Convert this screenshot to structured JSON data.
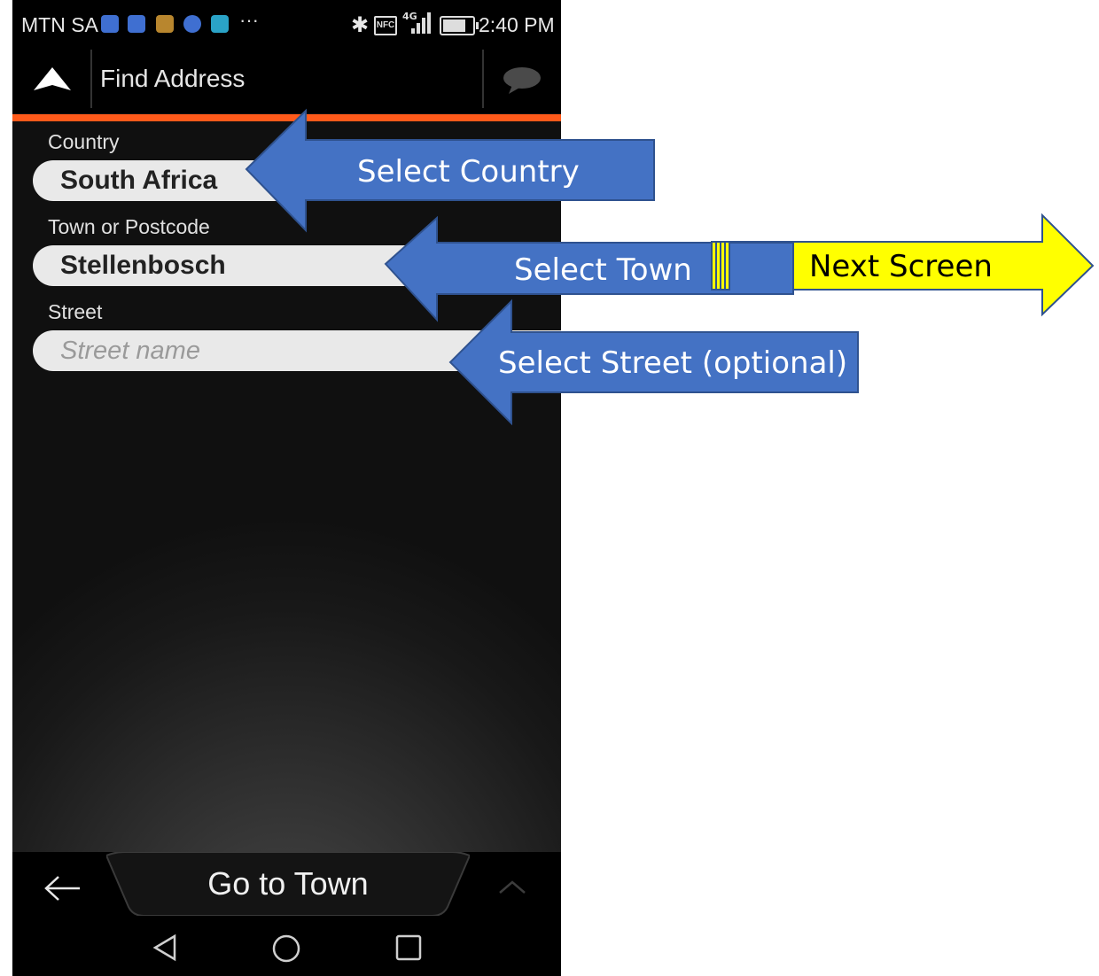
{
  "status_bar": {
    "carrier": "MTN SA",
    "more": "···",
    "network": "4G",
    "nfc": "NFC",
    "time": "2:40 PM",
    "battery_level": 0.7,
    "notification_icons": [
      "location-icon",
      "sync-icon",
      "storage-icon",
      "drive-icon",
      "messenger-icon"
    ]
  },
  "app_bar": {
    "title": "Find Address"
  },
  "form": {
    "country_label": "Country",
    "country_value": "South Africa",
    "town_label": "Town or Postcode",
    "town_value": "Stellenbosch",
    "street_label": "Street",
    "street_placeholder": "Street name"
  },
  "bottom_bar": {
    "action_label": "Go to Town"
  },
  "annotations": {
    "select_country": "Select Country",
    "select_town": "Select Town",
    "next_screen": "Next Screen",
    "select_street": "Select Street (optional)"
  },
  "colors": {
    "accent": "#ff5a1a",
    "annotation_blue": "#4472c4",
    "annotation_yellow": "#ffff00"
  }
}
